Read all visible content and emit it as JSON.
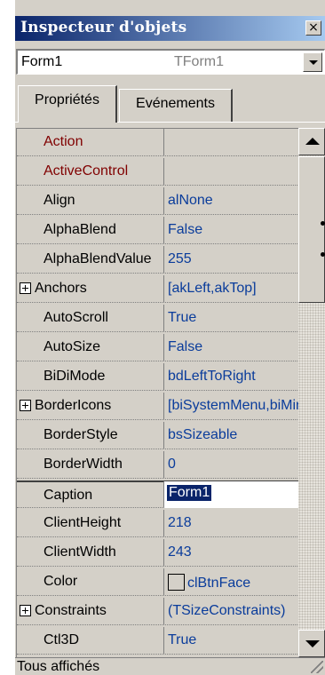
{
  "window": {
    "title": "Inspecteur d'objets",
    "close_glyph": "×"
  },
  "object_selector": {
    "name": "Form1",
    "type": "TForm1"
  },
  "tabs": [
    {
      "label": "Propriétés",
      "active": true
    },
    {
      "label": "Evénements",
      "active": false
    }
  ],
  "properties": [
    {
      "name": "Action",
      "value": "",
      "red": true
    },
    {
      "name": "ActiveControl",
      "value": "",
      "red": true
    },
    {
      "name": "Align",
      "value": "alNone"
    },
    {
      "name": "AlphaBlend",
      "value": "False"
    },
    {
      "name": "AlphaBlendValue",
      "value": "255"
    },
    {
      "name": "Anchors",
      "value": "[akLeft,akTop]",
      "expandable": true
    },
    {
      "name": "AutoScroll",
      "value": "True"
    },
    {
      "name": "AutoSize",
      "value": "False"
    },
    {
      "name": "BiDiMode",
      "value": "bdLeftToRight"
    },
    {
      "name": "BorderIcons",
      "value": "[biSystemMenu,biMinimize,biMaximize]",
      "expandable": true
    },
    {
      "name": "BorderStyle",
      "value": "bsSizeable"
    },
    {
      "name": "BorderWidth",
      "value": "0"
    },
    {
      "name": "Caption",
      "value": "Form1",
      "selected": true
    },
    {
      "name": "ClientHeight",
      "value": "218"
    },
    {
      "name": "ClientWidth",
      "value": "243"
    },
    {
      "name": "Color",
      "value": "clBtnFace",
      "swatch": true
    },
    {
      "name": "Constraints",
      "value": "(TSizeConstraints)",
      "expandable": true
    },
    {
      "name": "Ctl3D",
      "value": "True"
    }
  ],
  "status": {
    "text": "Tous affichés"
  },
  "colors": {
    "title_start": "#0a246a",
    "title_end": "#a6caf0",
    "value_text": "#0a3c9b",
    "event_props": "#800000"
  }
}
